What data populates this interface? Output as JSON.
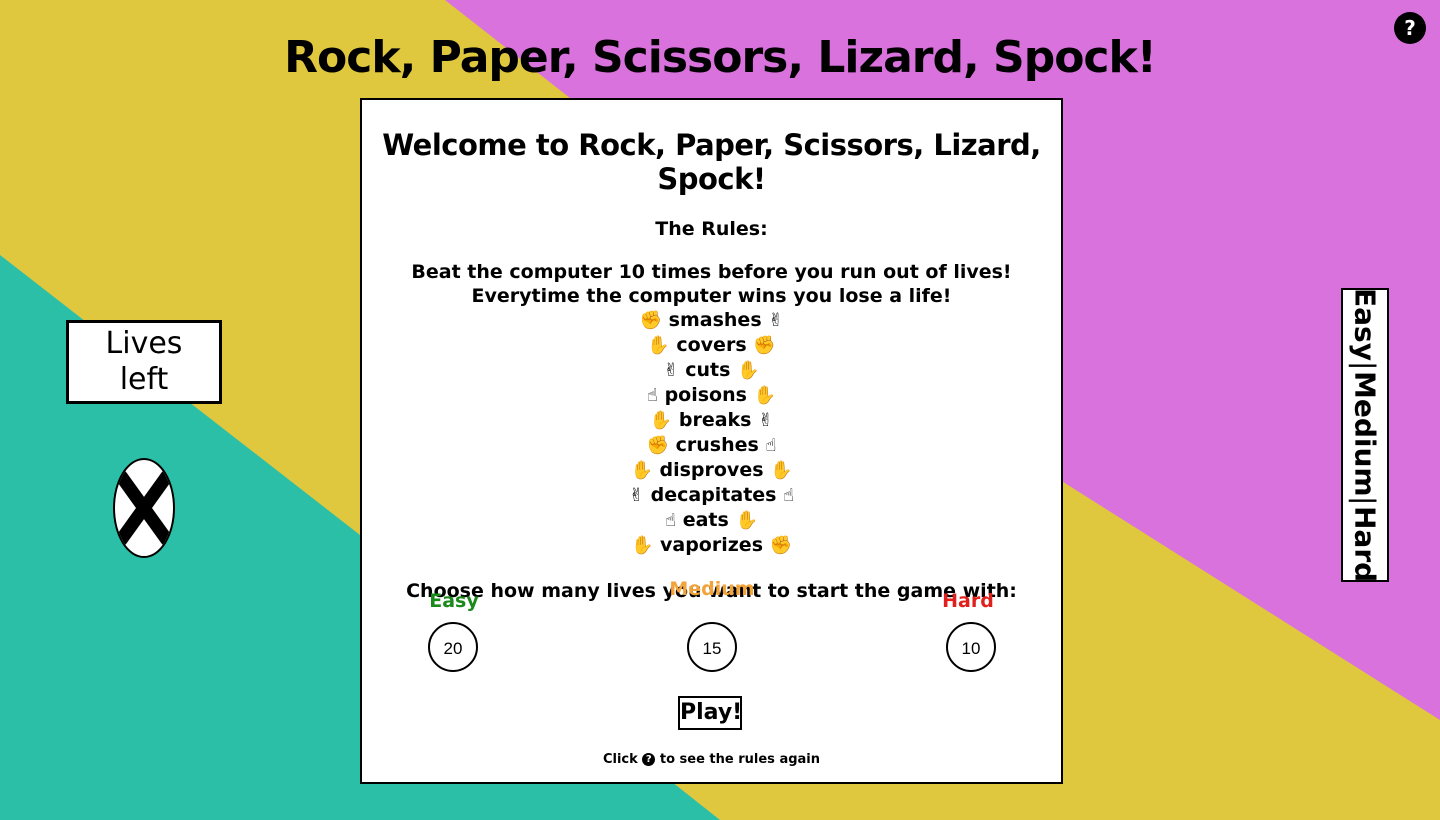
{
  "header": {
    "title": "Rock, Paper, Scissors, Lizard, Spock!",
    "help_icon": "?"
  },
  "lives_panel": {
    "label_line1": "Lives",
    "label_line2": "left"
  },
  "difficulty_tab": {
    "easy": "Easy",
    "medium": "Medium",
    "hard": "Hard",
    "separator": "|"
  },
  "welcome": {
    "title": "Welcome to Rock, Paper, Scissors, Lizard, Spock!",
    "rules_heading": "The Rules:",
    "intro_line1": "Beat the computer 10 times before you run out of lives!",
    "intro_line2": "Everytime the computer wins you lose a life!",
    "rules": [
      {
        "left": "✊",
        "verb": "smashes",
        "right": "✌"
      },
      {
        "left": "✋",
        "verb": "covers",
        "right": "✊"
      },
      {
        "left": "✌",
        "verb": "cuts",
        "right": "✋"
      },
      {
        "left": "☝",
        "verb": "poisons",
        "right": "✋"
      },
      {
        "left": "✋",
        "verb": "breaks",
        "right": "✌"
      },
      {
        "left": "✊",
        "verb": "crushes",
        "right": "☝"
      },
      {
        "left": "✋",
        "verb": "disproves",
        "right": "✋"
      },
      {
        "left": "✌",
        "verb": "decapitates",
        "right": "☝"
      },
      {
        "left": "☝",
        "verb": "eats",
        "right": "✋"
      },
      {
        "left": "✋",
        "verb": "vaporizes",
        "right": "✊"
      }
    ],
    "choose_text": "Choose how many lives you want to start the game with:",
    "levels": {
      "easy": {
        "label": "Easy",
        "lives": "20",
        "color": "#1a8a1a"
      },
      "medium": {
        "label": "Medium",
        "lives": "15",
        "color": "#f2a33a"
      },
      "hard": {
        "label": "Hard",
        "lives": "10",
        "color": "#e0201c"
      }
    },
    "play_label": "Play!",
    "footnote_before": "Click",
    "footnote_after": "to see the rules again"
  },
  "colors": {
    "background_yellow": "#dfc73e",
    "background_pink": "#da72de",
    "background_teal": "#2bbfa8"
  },
  "icons": {
    "life_marker": "x-mark-icon",
    "help": "question-circle-icon"
  }
}
